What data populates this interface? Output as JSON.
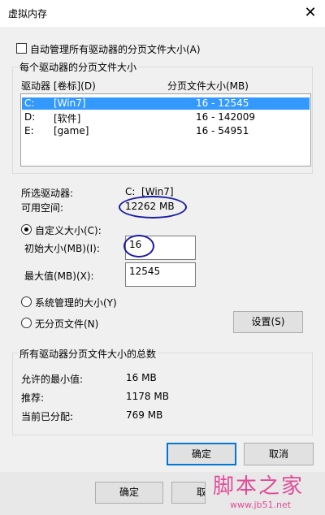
{
  "window": {
    "title": "虚拟内存",
    "close_glyph": "✕"
  },
  "auto_manage": {
    "label": "自动管理所有驱动器的分页文件大小(A)",
    "checked": false
  },
  "drives_group": {
    "title": "每个驱动器的分页文件大小",
    "col_drive": "驱动器 [卷标](D)",
    "col_size": "分页文件大小(MB)",
    "rows": [
      {
        "drive": "C:",
        "label": "[Win7]",
        "size": "16 - 12545",
        "selected": true
      },
      {
        "drive": "D:",
        "label": "[软件]",
        "size": "16 - 142009",
        "selected": false
      },
      {
        "drive": "E:",
        "label": "[game]",
        "size": "16 - 54951",
        "selected": false
      }
    ]
  },
  "selected": {
    "drive_label": "所选驱动器:",
    "drive_value": "C:  [Win7]",
    "space_label": "可用空间:",
    "space_value": "12262 MB"
  },
  "custom": {
    "label": "自定义大小(C):",
    "initial_label": "初始大小(MB)(I):",
    "initial_value": "16",
    "max_label": "最大值(MB)(X):",
    "max_value": "12545"
  },
  "system_managed": {
    "label": "系统管理的大小(Y)"
  },
  "no_paging": {
    "label": "无分页文件(N)"
  },
  "set_button": "设置(S)",
  "totals_group": {
    "title": "所有驱动器分页文件大小的总数",
    "min_label": "允许的最小值:",
    "min_value": "16 MB",
    "rec_label": "推荐:",
    "rec_value": "1178 MB",
    "cur_label": "当前已分配:",
    "cur_value": "769 MB"
  },
  "buttons": {
    "ok": "确定",
    "cancel": "取消"
  },
  "underlying_buttons": {
    "ok": "确定",
    "partial": "取"
  },
  "watermark": {
    "text": "脚本之家",
    "url": "www.jb51.net"
  },
  "colors": {
    "selection": "#3399ff",
    "accent": "#0078d7",
    "annotation": "#1a1aa6"
  }
}
